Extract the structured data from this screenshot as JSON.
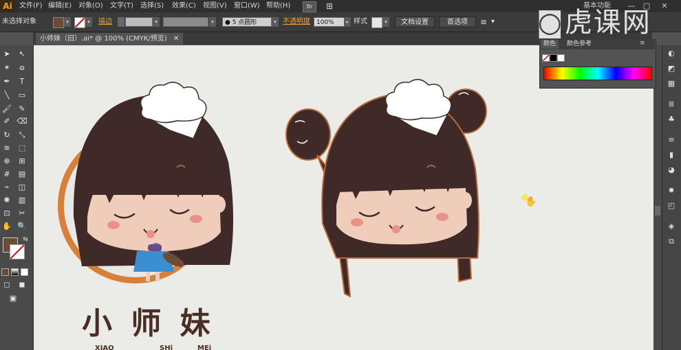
{
  "app": {
    "logo": "Ai"
  },
  "menu": [
    "文件(F)",
    "编辑(E)",
    "对象(O)",
    "文字(T)",
    "选择(S)",
    "效果(C)",
    "视图(V)",
    "窗口(W)",
    "帮助(H)"
  ],
  "menu_icons": [
    "Br",
    "⊞"
  ],
  "workspace": "基本功能",
  "window_buttons": [
    "—",
    "□",
    "✕"
  ],
  "control": {
    "selection": "未选择对象",
    "stroke_label": "描边",
    "brush_value": "5 点圆形",
    "opacity_label": "不透明度",
    "opacity_value": "100%",
    "style_label": "样式",
    "doc_setup": "文档设置",
    "preferences": "首选项"
  },
  "doc_tab": "小师妹（旧）.ai* @ 100% (CMYK/预览)",
  "panel": {
    "tab_color": "颜色",
    "tab_guide": "颜色参考"
  },
  "watermark": "虎课网",
  "artwork": {
    "logo_main": "小 师 妹",
    "pinyin": [
      "XIAO",
      "SHi",
      "MEi"
    ]
  },
  "colors": {
    "fill": "#6b4c35",
    "hair": "#3f2a28",
    "face": "#f0cdbb",
    "ring": "#e0873a",
    "shirt": "#3b8fd0",
    "blush": "#e9928a"
  }
}
